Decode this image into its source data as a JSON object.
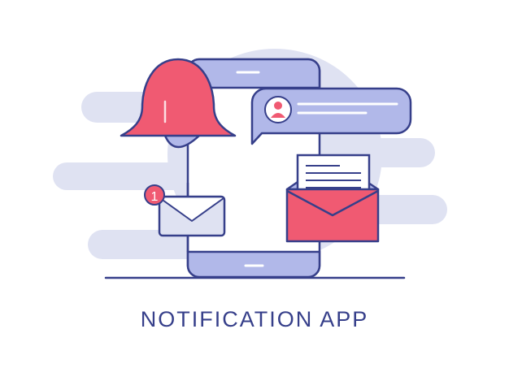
{
  "illustration": {
    "caption": "NOTIFICATION APP",
    "badge_count": "1",
    "icons": [
      "bell-icon",
      "smartphone-icon",
      "chat-bubble-icon",
      "user-avatar-icon",
      "envelope-icon",
      "open-envelope-letter-icon"
    ]
  },
  "colors": {
    "outline": "#363f8a",
    "accent_red": "#f05a72",
    "light_blue": "#dfe2f2",
    "mid_blue": "#b1b8e9",
    "white": "#ffffff"
  }
}
